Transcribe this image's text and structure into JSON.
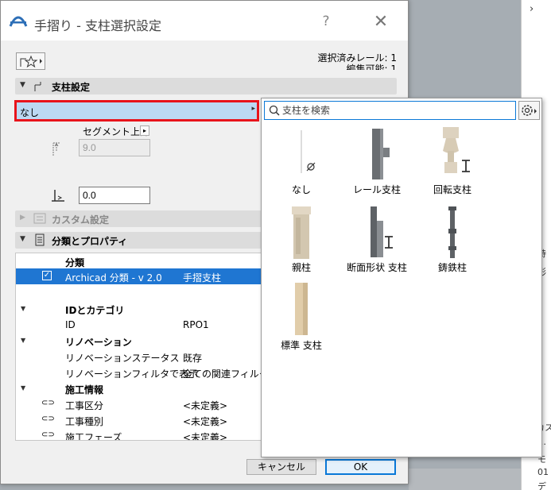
{
  "window": {
    "title": "手摺り - 支柱選択設定",
    "help_glyph": "?",
    "close_glyph": "✕"
  },
  "info": {
    "selected_rails": "選択済みレール: 1",
    "editable_partial": "編集可能: 1"
  },
  "sections": {
    "post_settings": "支柱設定",
    "custom_settings": "カスタム設定",
    "classification": "分類とプロパティ"
  },
  "post_select": {
    "value": "なし",
    "arrow": "▸"
  },
  "segment": {
    "label": "セグメント上部",
    "arrow": "▸"
  },
  "height": {
    "value": "9.0"
  },
  "offset": {
    "value": "0.0"
  },
  "properties": {
    "classification_header": "分類",
    "classification_row": {
      "name": "Archicad 分類 - v 2.0",
      "value": "手摺支柱",
      "checked": true
    },
    "groups": [
      {
        "label": "IDとカテゴリ",
        "rows": [
          {
            "name": "ID",
            "value": "RPO1"
          }
        ]
      },
      {
        "label": "リノベーション",
        "rows": [
          {
            "name": "リノベーションステータス",
            "value": "既存"
          },
          {
            "name": "リノベーションフィルタで表示",
            "value": "全ての関連フィルタ"
          }
        ]
      },
      {
        "label": "施工情報",
        "rows": [
          {
            "name": "工事区分",
            "value": "<未定義>"
          },
          {
            "name": "工事種別",
            "value": "<未定義>"
          },
          {
            "name": "施工フェーズ",
            "value": "<未定義>"
          }
        ]
      }
    ]
  },
  "buttons": {
    "cancel": "キャンセル",
    "ok": "OK"
  },
  "picker": {
    "search_placeholder": "支柱を検索",
    "items": [
      {
        "label": "なし",
        "icon": "none-post-icon"
      },
      {
        "label": "レール支柱",
        "icon": "rail-post-icon"
      },
      {
        "label": "回転支柱",
        "icon": "turned-post-icon"
      },
      {
        "label": "親柱",
        "icon": "newel-post-icon"
      },
      {
        "label": "断面形状 支柱",
        "icon": "profile-post-icon"
      },
      {
        "label": "鋳鉄柱",
        "icon": "cast-iron-post-icon"
      },
      {
        "label": "標準 支柱",
        "icon": "standard-post-icon"
      }
    ]
  },
  "background": {
    "right_texts": [
      "持",
      "形",
      "カス",
      "…",
      "モ",
      "01",
      "デ"
    ]
  },
  "colors": {
    "accent": "#1f76d2",
    "highlight_border": "#e8141c",
    "select_fill": "#bcd9f3"
  }
}
